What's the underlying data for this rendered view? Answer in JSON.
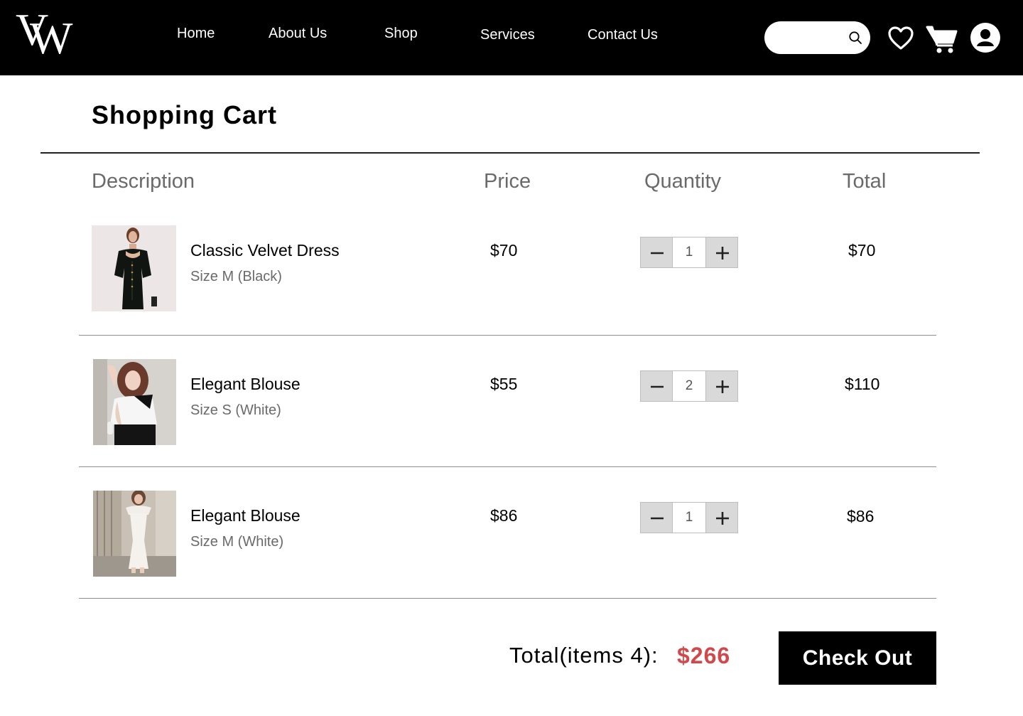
{
  "header": {
    "logo_letters": [
      "V",
      "W"
    ],
    "nav": [
      "Home",
      "About Us",
      "Shop",
      "Services",
      "Contact Us"
    ],
    "search": {
      "value": "",
      "placeholder": ""
    },
    "icons": [
      "search-icon",
      "heart-icon",
      "cart-icon",
      "user-icon"
    ]
  },
  "cart": {
    "title": "Shopping Cart",
    "columns": {
      "description": "Description",
      "price": "Price",
      "quantity": "Quantity",
      "total": "Total"
    },
    "items": [
      {
        "name": "Classic Velvet Dress",
        "variant": "Size M (Black)",
        "price": "$70",
        "quantity": "1",
        "total": "$70",
        "thumbnail": "woman in black velvet mini dress"
      },
      {
        "name": "Elegant Blouse",
        "variant": "Size S (White)",
        "price": "$55",
        "quantity": "2",
        "total": "$110",
        "thumbnail": "woman in white blouse with black bow"
      },
      {
        "name": "Elegant Blouse",
        "variant": "Size M (White)",
        "price": "$86",
        "quantity": "1",
        "total": "$86",
        "thumbnail": "woman in long white dress on street"
      }
    ],
    "summary_label": "Total(items 4):",
    "summary_amount": "$266",
    "checkout_label": "Check Out"
  },
  "colors": {
    "header_bg": "#000000",
    "accent_total": "#d0484a",
    "qty_button_bg": "#d9d9d9",
    "muted_text": "#6a6a6a"
  }
}
